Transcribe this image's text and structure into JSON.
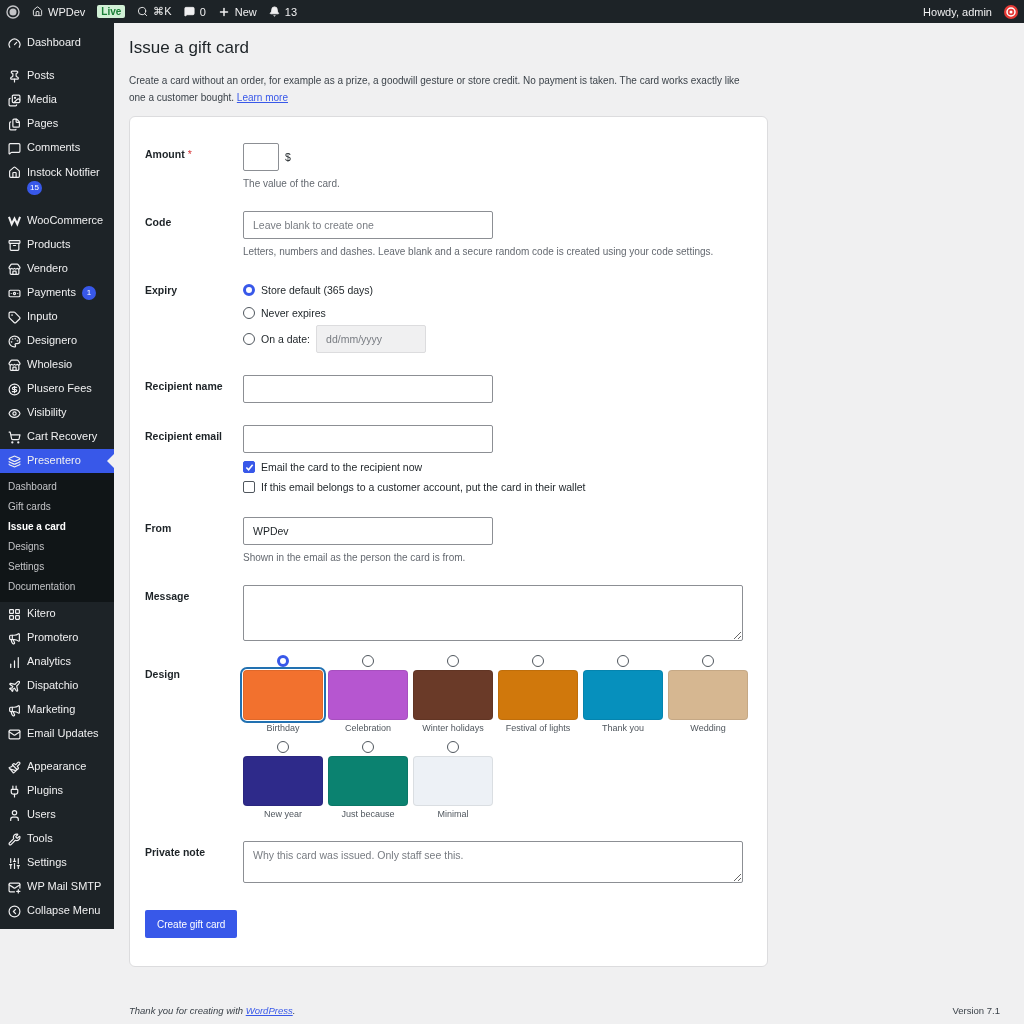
{
  "top_bar": {
    "site": "WPDev",
    "status_badge": "Live",
    "search_shortcut": "⌘K",
    "comments": "0",
    "new": "New",
    "notifications": "13",
    "greeting": "Howdy, admin"
  },
  "sidebar": {
    "groups": [
      [
        {
          "label": "Dashboard",
          "selected": false
        }
      ],
      [
        {
          "label": "Posts",
          "selected": false
        },
        {
          "label": "Media",
          "selected": false
        },
        {
          "label": "Pages",
          "selected": false
        },
        {
          "label": "Comments",
          "selected": false
        },
        {
          "label": "Instock Notifier",
          "selected": false,
          "badge": "15"
        }
      ],
      [
        {
          "label": "WooCommerce",
          "selected": false
        },
        {
          "label": "Products",
          "selected": false
        },
        {
          "label": "Vendero",
          "selected": false
        },
        {
          "label": "Payments",
          "selected": false,
          "badge": "1"
        },
        {
          "label": "Inputo",
          "selected": false
        },
        {
          "label": "Designero",
          "selected": false
        },
        {
          "label": "Wholesio",
          "selected": false
        },
        {
          "label": "Plusero Fees",
          "selected": false
        },
        {
          "label": "Visibility",
          "selected": false
        },
        {
          "label": "Cart Recovery",
          "selected": false
        },
        {
          "label": "Presentero",
          "selected": true,
          "submenu": [
            {
              "label": "Dashboard",
              "selected": false
            },
            {
              "label": "Gift cards",
              "selected": false
            },
            {
              "label": "Issue a card",
              "selected": true
            },
            {
              "label": "Designs",
              "selected": false
            },
            {
              "label": "Settings",
              "selected": false
            },
            {
              "label": "Documentation",
              "selected": false
            }
          ]
        },
        {
          "label": "Kitero",
          "selected": false
        },
        {
          "label": "Promotero",
          "selected": false
        },
        {
          "label": "Analytics",
          "selected": false
        },
        {
          "label": "Dispatchio",
          "selected": false
        },
        {
          "label": "Marketing",
          "selected": false
        },
        {
          "label": "Email Updates",
          "selected": false
        }
      ],
      [
        {
          "label": "Appearance",
          "selected": false
        },
        {
          "label": "Plugins",
          "selected": false
        },
        {
          "label": "Users",
          "selected": false
        },
        {
          "label": "Tools",
          "selected": false
        },
        {
          "label": "Settings",
          "selected": false
        },
        {
          "label": "WP Mail SMTP",
          "selected": false
        },
        {
          "label": "Collapse Menu",
          "selected": false
        }
      ]
    ]
  },
  "page": {
    "title": "Issue a gift card",
    "intro": "Create a card without an order, for example as a prize, a goodwill gesture or store credit. No payment is taken. The card works exactly like one a customer bought.",
    "intro_link": "Learn more"
  },
  "form": {
    "amount": {
      "label": "Amount",
      "required_mark": "*",
      "suffix": "$",
      "help": "The value of the card."
    },
    "code": {
      "label": "Code",
      "placeholder": "Leave blank to create one",
      "help": "Letters, numbers and dashes. Leave blank and a secure random code is created using your code settings."
    },
    "expiry": {
      "label": "Expiry",
      "options": [
        {
          "label": "Store default (365 days)",
          "selected": true
        },
        {
          "label": "Never expires",
          "selected": false
        },
        {
          "label": "On a date:",
          "selected": false,
          "date_placeholder": "dd/mm/yyyy",
          "date_disabled": true
        }
      ]
    },
    "recipient_name": {
      "label": "Recipient name"
    },
    "recipient_email": {
      "label": "Recipient email",
      "checkboxes": [
        {
          "label": "Email the card to the recipient now",
          "checked": true
        },
        {
          "label": "If this email belongs to a customer account, put the card in their wallet",
          "checked": false
        }
      ]
    },
    "from": {
      "label": "From",
      "value": "WPDev",
      "help": "Shown in the email as the person the card is from."
    },
    "message": {
      "label": "Message"
    },
    "design": {
      "label": "Design",
      "options": [
        {
          "label": "Birthday",
          "selected": true,
          "color": "#f2712e"
        },
        {
          "label": "Celebration",
          "selected": false,
          "color": "#b656d0"
        },
        {
          "label": "Winter holidays",
          "selected": false,
          "color": "#6a3a28"
        },
        {
          "label": "Festival of lights",
          "selected": false,
          "color": "#d0780c"
        },
        {
          "label": "Thank you",
          "selected": false,
          "color": "#0690bd"
        },
        {
          "label": "Wedding",
          "selected": false,
          "color": "#d6b791"
        },
        {
          "label": "New year",
          "selected": false,
          "color": "#2e2a8a"
        },
        {
          "label": "Just because",
          "selected": false,
          "color": "#0b8270"
        },
        {
          "label": "Minimal",
          "selected": false,
          "color": "#edf1f6"
        }
      ]
    },
    "private_note": {
      "label": "Private note",
      "placeholder": "Why this card was issued. Only staff see this."
    },
    "submit": "Create gift card"
  },
  "footer": {
    "thanks": "Thank you for creating with",
    "link": "WordPress",
    "thanks_end": ".",
    "version": "Version 7.1"
  }
}
